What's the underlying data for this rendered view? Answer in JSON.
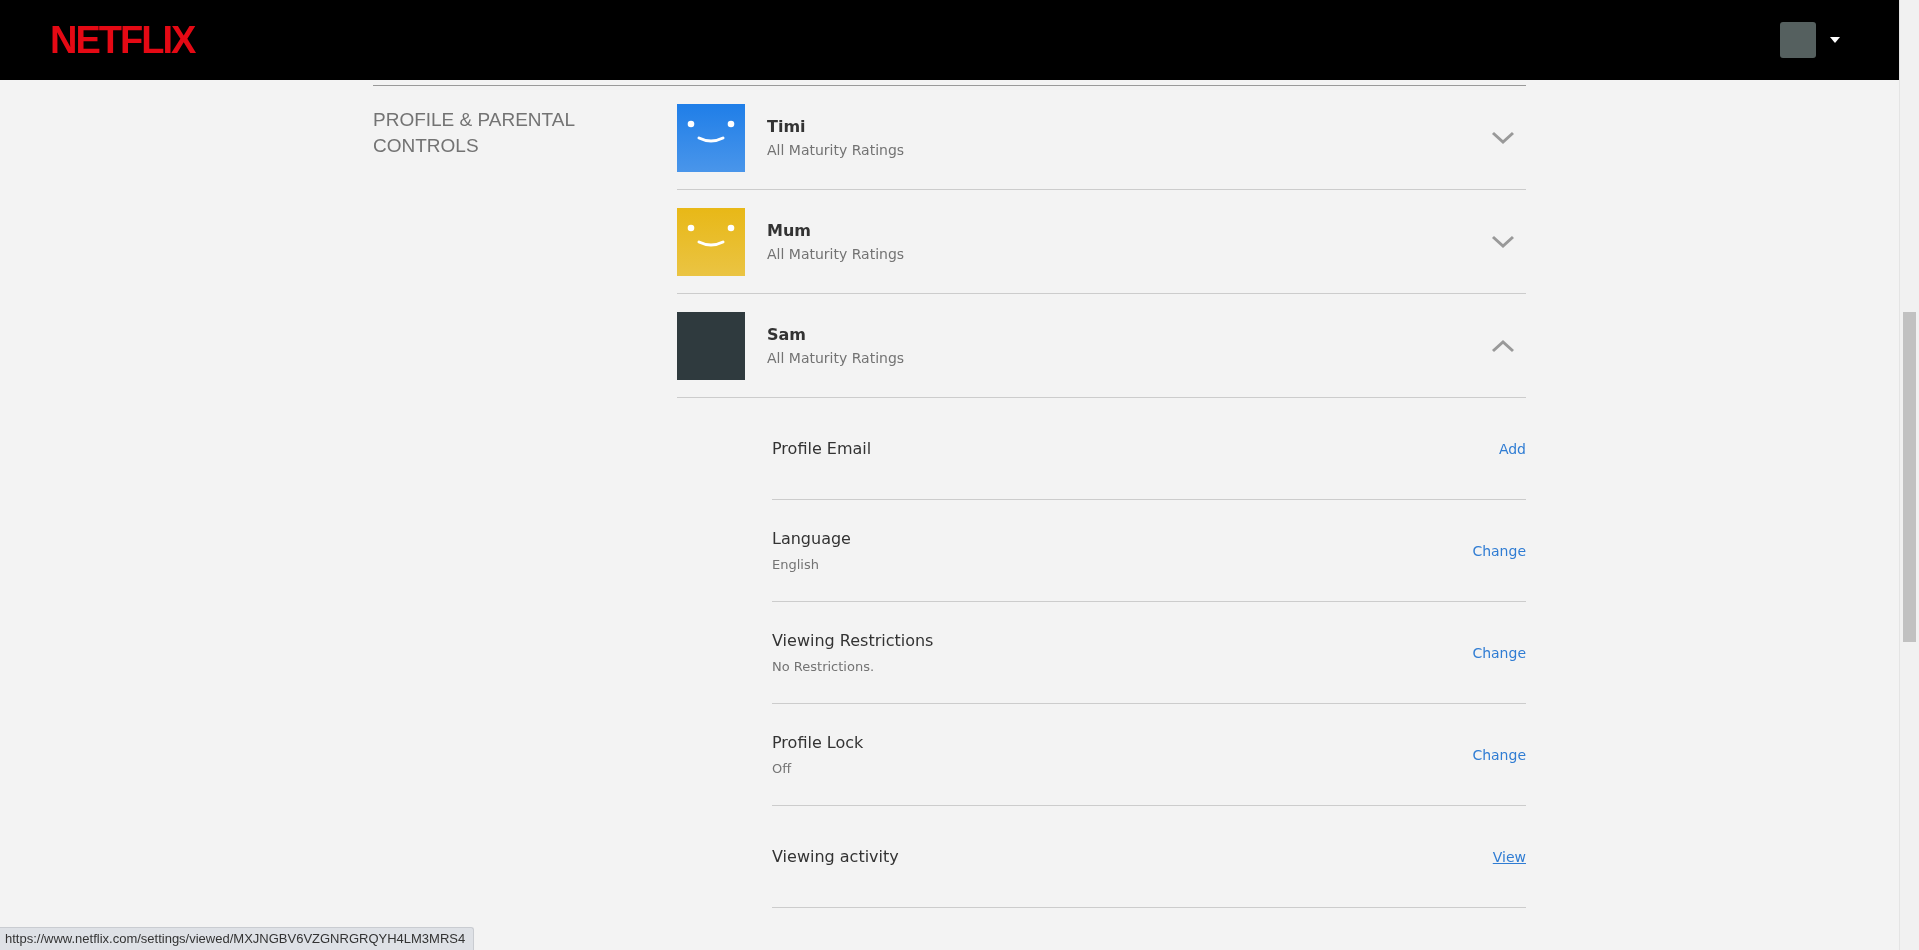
{
  "header": {
    "logo": "NETFLIX"
  },
  "section": {
    "title": "PROFILE & PARENTAL CONTROLS"
  },
  "profiles": [
    {
      "name": "Timi",
      "subtitle": "All Maturity Ratings",
      "kind": "smiley",
      "color": "#1f7ee8",
      "expanded": false
    },
    {
      "name": "Mum",
      "subtitle": "All Maturity Ratings",
      "kind": "smiley",
      "color": "#e8b817",
      "expanded": false
    },
    {
      "name": "Sam",
      "subtitle": "All Maturity Ratings",
      "kind": "photo",
      "color": "#2f3a3e",
      "expanded": true
    }
  ],
  "settings": [
    {
      "label": "Profile Email",
      "action": "Add",
      "hovered": false
    },
    {
      "label": "Language",
      "value": "English",
      "action": "Change",
      "hovered": false
    },
    {
      "label": "Viewing Restrictions",
      "value": "No Restrictions.",
      "action": "Change",
      "hovered": false
    },
    {
      "label": "Profile Lock",
      "value": "Off",
      "action": "Change",
      "hovered": false
    },
    {
      "label": "Viewing activity",
      "action": "View",
      "hovered": true
    }
  ],
  "status_bar": {
    "url": "https://www.netflix.com/settings/viewed/MXJNGBV6VZGNRGRQYH4LM3MRS4"
  }
}
